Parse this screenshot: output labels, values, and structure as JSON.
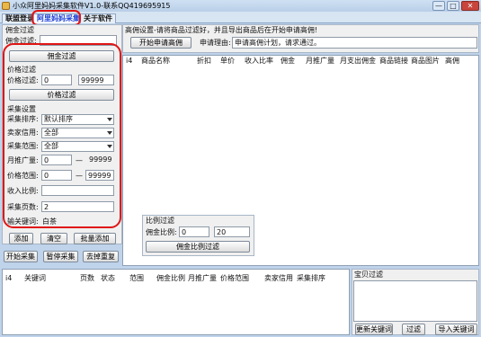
{
  "window": {
    "title": "小众阿里妈妈采集软件V1.0-联系QQ419695915",
    "min_label": "—",
    "max_label": "□",
    "close_label": "✕"
  },
  "tabs": [
    "联盟登录",
    "阿里妈妈采集",
    "关于软件"
  ],
  "left": {
    "commission_section": "佣金过滤",
    "commission_label": "佣金过滤:",
    "commission_button": "佣金过滤",
    "price_section": "价格过滤",
    "price_label": "价格过滤:",
    "price_min": "0",
    "price_max": "99999",
    "price_button": "价格过滤",
    "collect_section": "采集设置",
    "sort_label": "采集排序:",
    "sort_value": "默认排序",
    "credit_label": "卖家信用:",
    "credit_value": "全部",
    "range_label": "采集范围:",
    "range_value": "全部",
    "monthly_label": "月推广量:",
    "monthly_min": "0",
    "monthly_dash": "—",
    "monthly_max": "99999",
    "pricerange_label": "价格范围:",
    "pricerange_min": "0",
    "pricerange_dash": "—",
    "pricerange_max": "99999",
    "ratio_label": "收入比例:",
    "ratio_value": "",
    "pages_label": "采集页数:",
    "pages_value": "2",
    "keyword_label": "输关键词:",
    "keyword_value": "白茶"
  },
  "left_buttons": {
    "add": "添加",
    "clear": "清空",
    "batch_add": "批量添加",
    "start": "开始采集",
    "pause": "暂停采集",
    "dedupe": "去掉重复"
  },
  "right_top": {
    "section_label": "高佣设置-请将商品过滤好，并且导出商品后在开始申请高佣!",
    "start_button": "开始申请高佣",
    "reason_label": "申请理由:",
    "reason_value": "申请高佣计划，请求通过。"
  },
  "product_table": {
    "columns": [
      "i4",
      "商品名称",
      "折扣",
      "单价",
      "收入比率",
      "佣金",
      "月推广量",
      "月支出佣金",
      "商品链接",
      "商品图片",
      "高佣"
    ]
  },
  "ratio_filter": {
    "section": "比例过滤",
    "label": "佣金比例:",
    "min": "0",
    "max": "20",
    "button": "佣金比例过滤"
  },
  "keyword_table": {
    "columns": [
      "i4",
      "关键词",
      "页数",
      "状态",
      "范围",
      "佣金比例",
      "月推广量",
      "价格范围",
      "卖家信用",
      "采集排序"
    ]
  },
  "baby_filter": {
    "section": "宝贝过滤",
    "update_button": "更新关键词",
    "filter_button": "过滤",
    "import_button": "导入关键词"
  }
}
